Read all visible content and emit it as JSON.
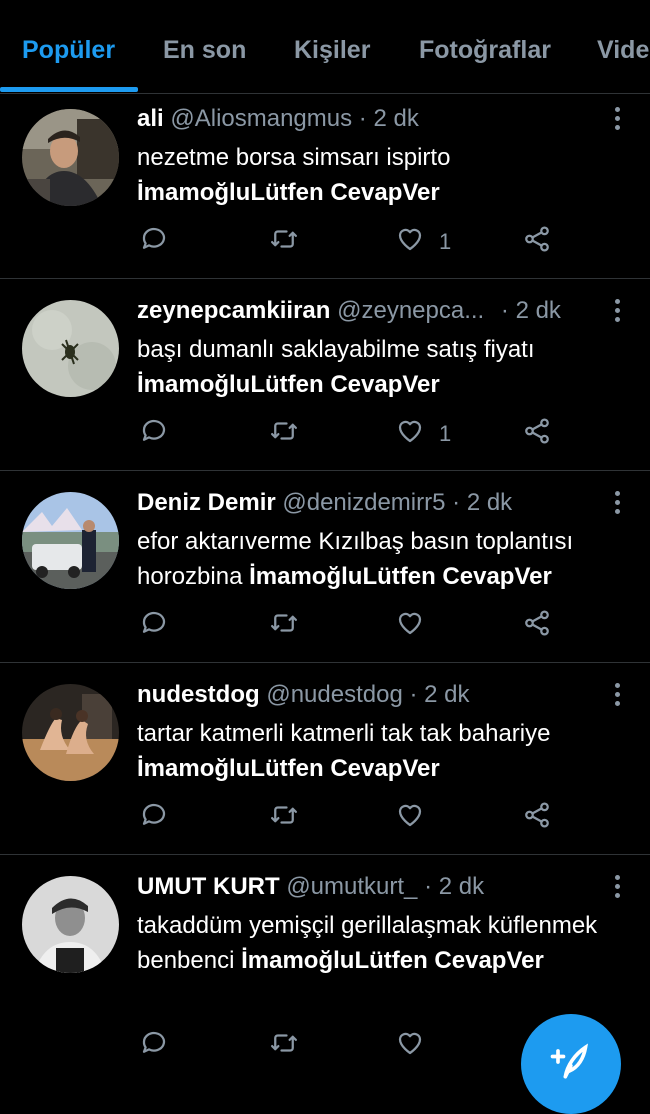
{
  "tabs": [
    "Popüler",
    "En son",
    "Kişiler",
    "Fotoğraflar",
    "Vide"
  ],
  "colors": {
    "accent": "#1d9bf0",
    "muted": "#8b98a5",
    "divider": "#2f3336",
    "background": "#000000"
  },
  "tweets": [
    {
      "name": "ali",
      "handle": "@Aliosmangmus",
      "dot": "·",
      "time": "2 dk",
      "text": "nezetme borsa simsarı ispirto",
      "tag": "İmamoğluLütfen CevapVer",
      "likes": "1"
    },
    {
      "name": "zeynepcamkiiran",
      "handle": "@zeynepca...",
      "dot": "·",
      "time": "2 dk",
      "text": "başı dumanlı saklayabilme satış fiyatı",
      "tag": "İmamoğluLütfen CevapVer",
      "likes": "1"
    },
    {
      "name": "Deniz Demir",
      "handle": "@denizdemirr5",
      "dot": "·",
      "time": "2 dk",
      "text": "efor aktarıverme Kızılbaş basın toplantısı horozbina",
      "tag": "İmamoğluLütfen CevapVer",
      "likes": ""
    },
    {
      "name": "nudestdog",
      "handle": "@nudestdog",
      "dot": "·",
      "time": "2 dk",
      "text": "tartar katmerli katmerli tak tak bahariye",
      "tag": "İmamoğluLütfen CevapVer",
      "likes": ""
    },
    {
      "name": "UMUT KURT",
      "handle": "@umutkurt_",
      "dot": "·",
      "time": "2 dk",
      "text": "takaddüm yemişçil gerillalaşmak küflenmek benbenci",
      "tag": "İmamoğluLütfen CevapVer",
      "likes": ""
    }
  ],
  "icons": {
    "reply": "reply-icon",
    "retweet": "retweet-icon",
    "like": "heart-icon",
    "share": "share-icon",
    "more": "more-vertical-icon",
    "compose": "compose-tweet-icon"
  }
}
